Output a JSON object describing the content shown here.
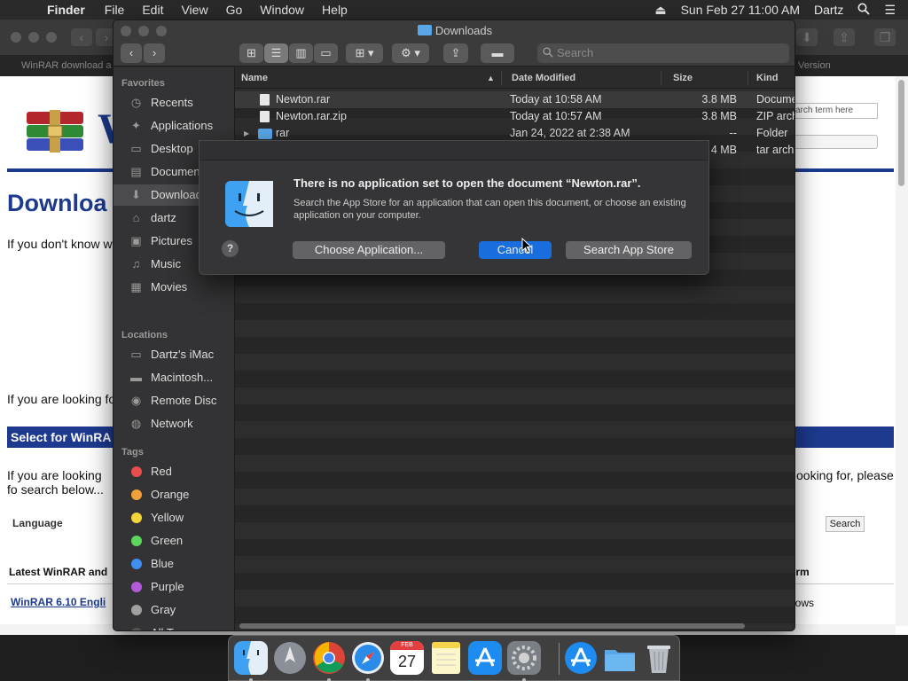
{
  "menubar": {
    "apple": "",
    "app": "Finder",
    "items": [
      "File",
      "Edit",
      "View",
      "Go",
      "Window",
      "Help"
    ],
    "clock": "Sun Feb 27  11:00 AM",
    "user": "Dartz"
  },
  "browser": {
    "tab_left": "WinRAR download a",
    "tab_right": "Version",
    "search_box": "arch term here",
    "heading": "Downloa",
    "text1": "If you don't know w",
    "text2": "If you are looking fo",
    "select_bar": "Select for WinRA",
    "text3": "If you are looking fo search below...",
    "text3_right": "ooking for, please",
    "language_label": "Language",
    "search_button": "Search",
    "latest": "Latest WinRAR and",
    "platform": "orm",
    "link1": "WinRAR 6.10 Engli",
    "windows": "dows",
    "logo_letter": "W"
  },
  "finder": {
    "title": "Downloads",
    "search_placeholder": "Search",
    "sidebar": {
      "favorites_label": "Favorites",
      "favorites": [
        {
          "label": "Recents",
          "icon": "clock-icon"
        },
        {
          "label": "Applications",
          "icon": "applications-icon"
        },
        {
          "label": "Desktop",
          "icon": "desktop-icon"
        },
        {
          "label": "Documents",
          "icon": "documents-icon"
        },
        {
          "label": "Downloads",
          "icon": "downloads-icon"
        },
        {
          "label": "dartz",
          "icon": "home-icon"
        },
        {
          "label": "Pictures",
          "icon": "pictures-icon"
        },
        {
          "label": "Music",
          "icon": "music-icon"
        },
        {
          "label": "Movies",
          "icon": "movies-icon"
        }
      ],
      "locations_label": "Locations",
      "locations": [
        {
          "label": "Dartz's iMac",
          "icon": "imac-icon"
        },
        {
          "label": "Macintosh...",
          "icon": "disk-icon"
        },
        {
          "label": "Remote Disc",
          "icon": "disc-icon"
        },
        {
          "label": "Network",
          "icon": "network-icon"
        }
      ],
      "tags_label": "Tags",
      "tags": [
        {
          "label": "Red",
          "color": "#e94e4e"
        },
        {
          "label": "Orange",
          "color": "#f0a13a"
        },
        {
          "label": "Yellow",
          "color": "#f2d43b"
        },
        {
          "label": "Green",
          "color": "#5cd65c"
        },
        {
          "label": "Blue",
          "color": "#3e8ff0"
        },
        {
          "label": "Purple",
          "color": "#b25ad9"
        },
        {
          "label": "Gray",
          "color": "#a0a0a0"
        },
        {
          "label": "All Tags...",
          "color": "#555555"
        }
      ]
    },
    "columns": {
      "name": "Name",
      "date": "Date Modified",
      "size": "Size",
      "kind": "Kind"
    },
    "files": [
      {
        "name": "Newton.rar",
        "date": "Today at 10:58 AM",
        "size": "3.8 MB",
        "kind": "Docume"
      },
      {
        "name": "Newton.rar.zip",
        "date": "Today at 10:57 AM",
        "size": "3.8 MB",
        "kind": "ZIP arch"
      },
      {
        "name": "rar",
        "date": "Jan 24, 2022 at 2:38 AM",
        "size": "--",
        "kind": "Folder"
      },
      {
        "name": "",
        "date": "",
        "size": "4 MB",
        "kind": "tar archi"
      }
    ]
  },
  "dialog": {
    "title": "There is no application set to open the document “Newton.rar”.",
    "message": "Search the App Store for an application that can open this document, or choose an existing application on your computer.",
    "help": "?",
    "choose": "Choose Application...",
    "cancel": "Cancel",
    "search_store": "Search App Store"
  },
  "dock": {
    "calendar_month": "FEB",
    "calendar_day": "27"
  }
}
